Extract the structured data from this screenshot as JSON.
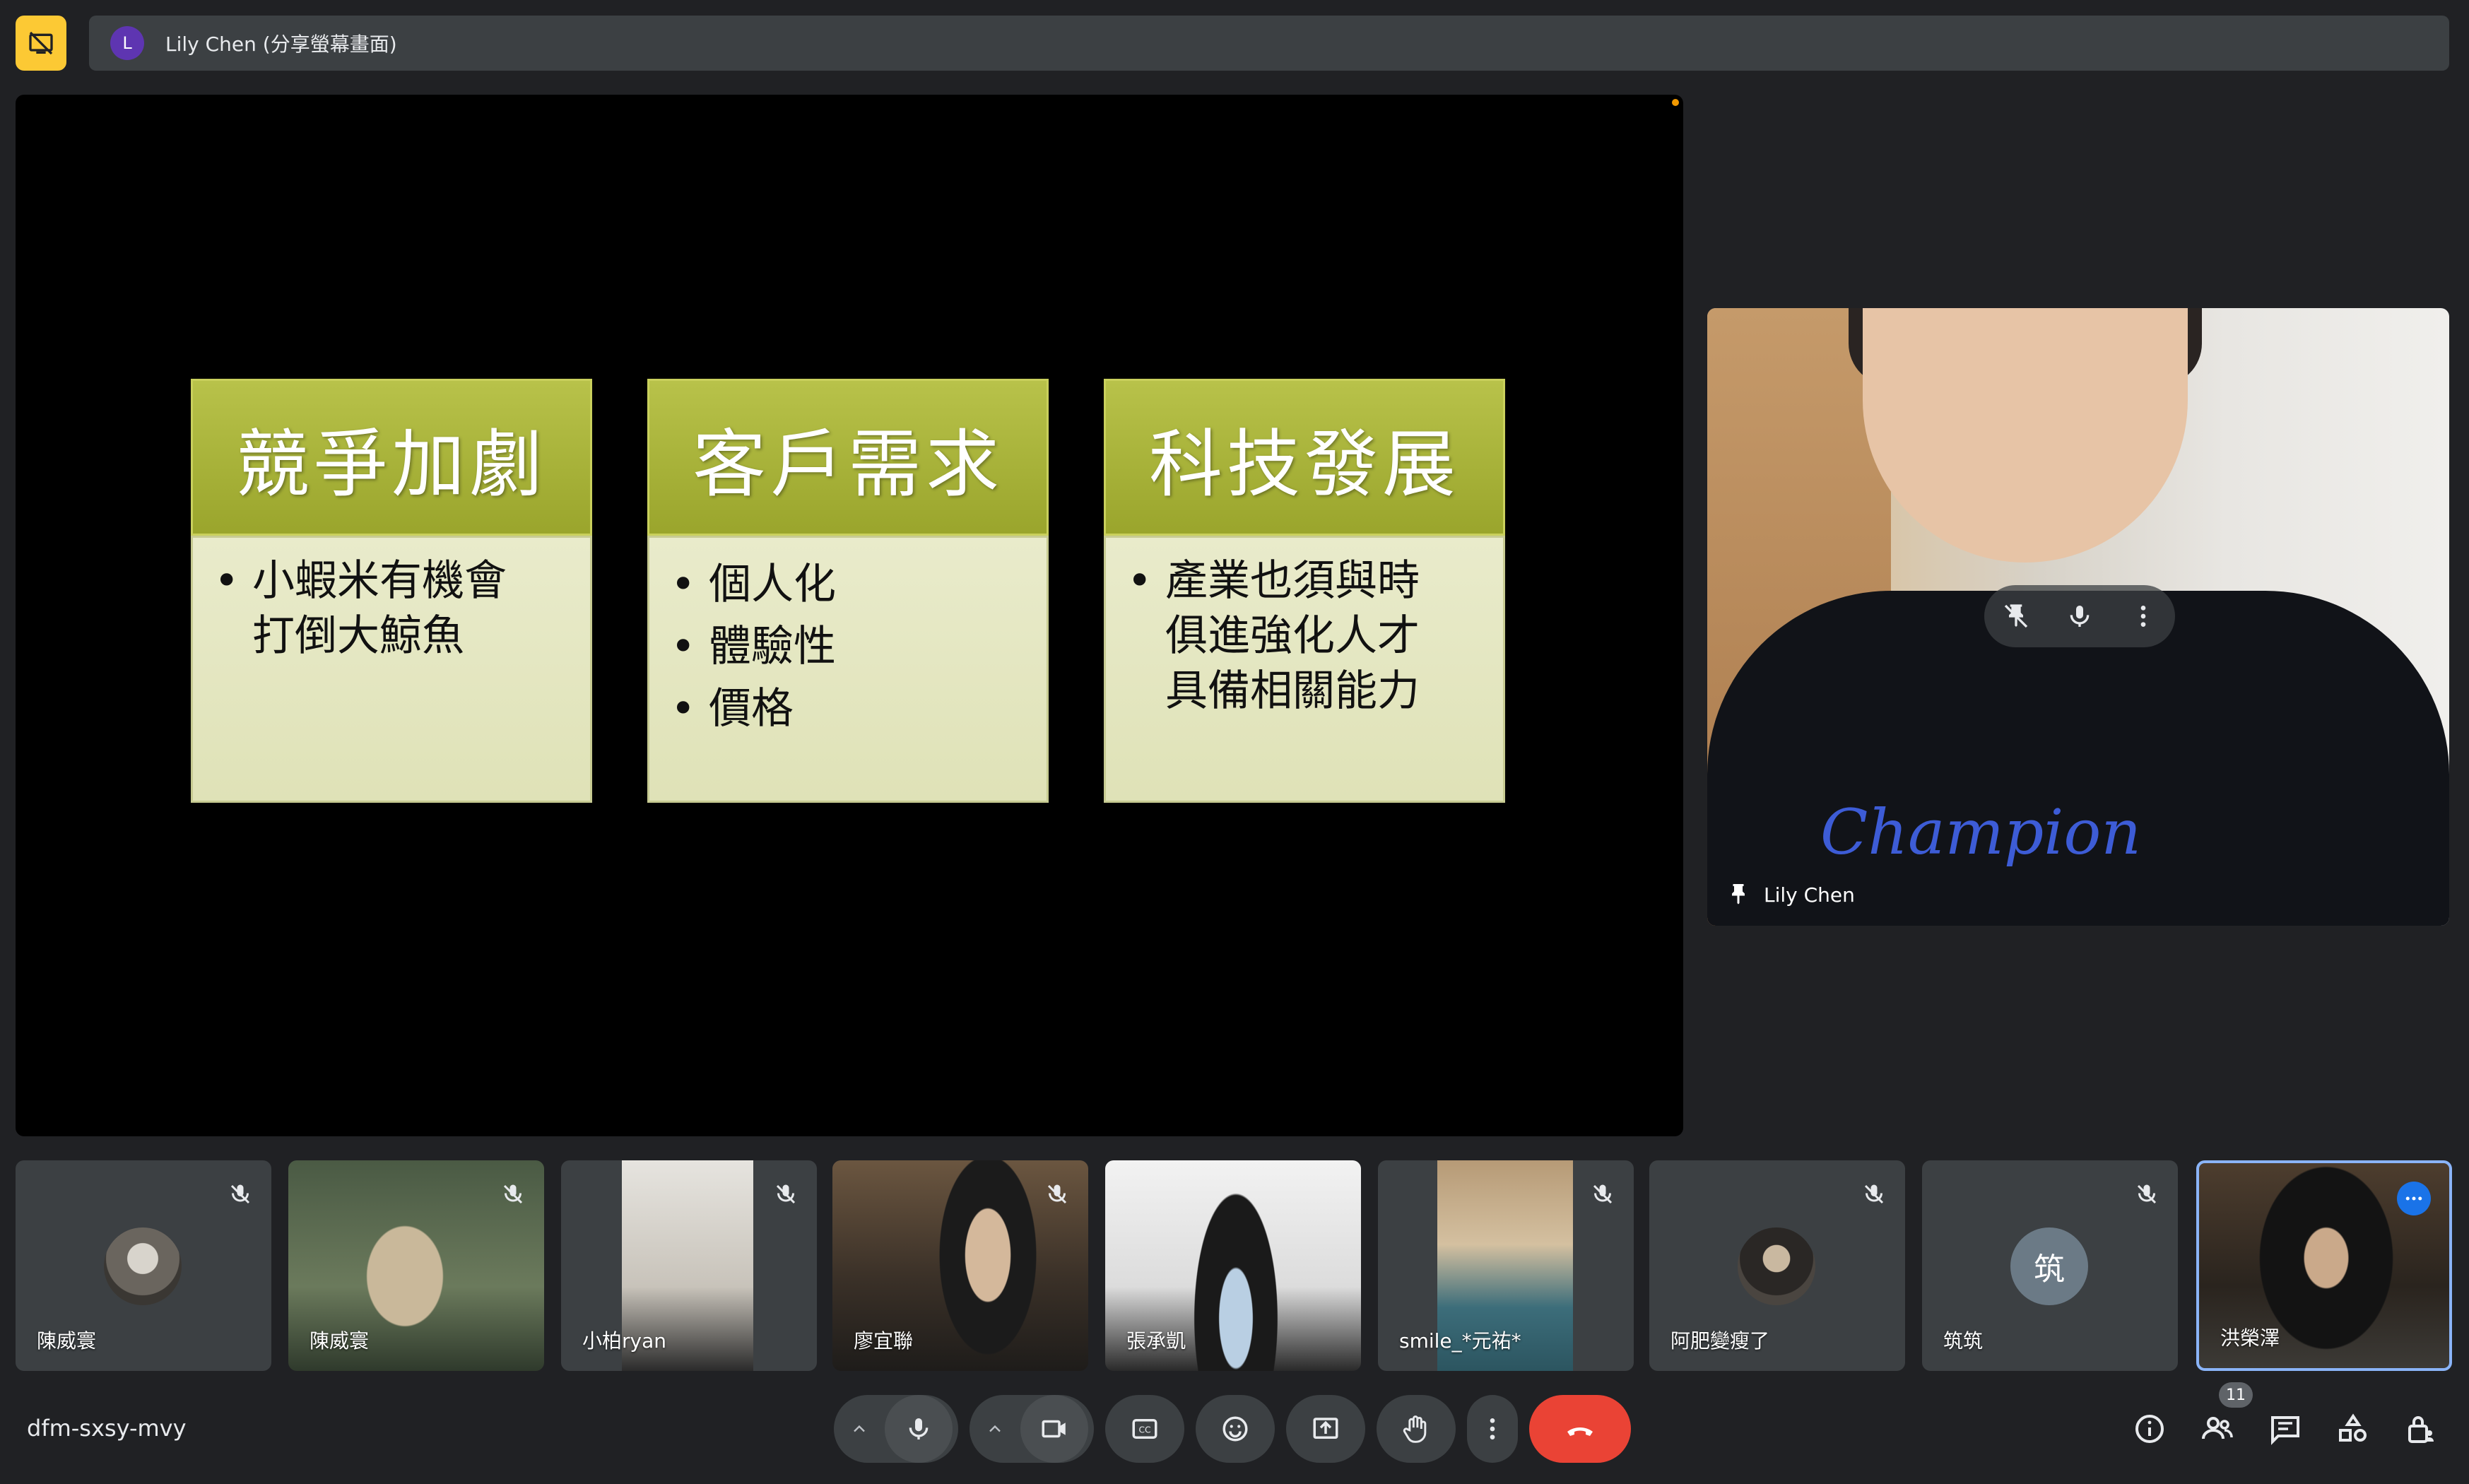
{
  "top_banner": {
    "avatar_letter": "L",
    "presenting_label": "Lily Chen (分享螢幕畫面)"
  },
  "slide": {
    "cards": [
      {
        "title": "競爭加劇",
        "items": [
          [
            "小蝦米有機會",
            "打倒大鯨魚"
          ]
        ]
      },
      {
        "title": "客戶需求",
        "items": [
          [
            "個人化"
          ],
          [
            "體驗性"
          ],
          [
            "價格"
          ]
        ]
      },
      {
        "title": "科技發展",
        "items": [
          [
            "產業也須與時",
            "俱進強化人才",
            "具備相關能力"
          ]
        ]
      }
    ]
  },
  "speaker": {
    "name": "Lily Chen",
    "shirt_logo": "Champion"
  },
  "participants": [
    {
      "name": "陳威寰",
      "type": "avatar-photo",
      "muted": true
    },
    {
      "name": "陳威寰",
      "type": "video",
      "muted": true
    },
    {
      "name": "小柏ryan",
      "type": "video",
      "muted": true
    },
    {
      "name": "廖宜聯",
      "type": "video",
      "muted": true
    },
    {
      "name": "張承凱",
      "type": "video",
      "muted": false
    },
    {
      "name": "smile_*元祐*",
      "type": "video",
      "muted": true
    },
    {
      "name": "阿肥變瘦了",
      "type": "avatar-photo",
      "muted": true
    },
    {
      "name": "筑筑",
      "type": "letter",
      "letter": "筑",
      "muted": true
    },
    {
      "name": "洪榮澤",
      "type": "video",
      "muted": false,
      "active": true
    }
  ],
  "bottom_bar": {
    "meeting_code": "dfm-sxsy-mvy",
    "people_count": "11"
  },
  "colors": {
    "background": "#202124",
    "tile": "#3c4043",
    "present_button": "#fcc934",
    "leave_button": "#ea4335",
    "slide_header": "#9aa52c",
    "slide_body": "#e2e5bd",
    "active_border": "#8ab4f8"
  }
}
